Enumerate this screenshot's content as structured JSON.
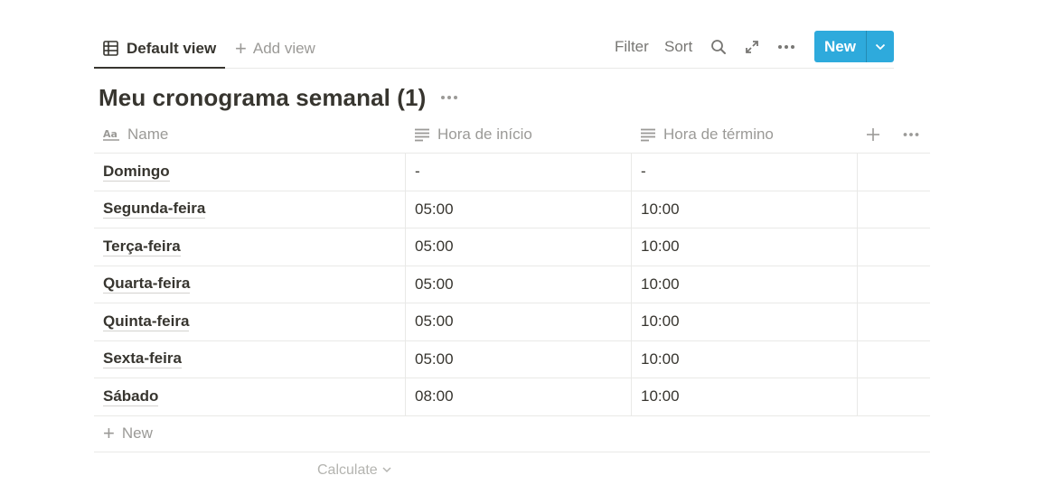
{
  "viewbar": {
    "default_tab": "Default view",
    "add_view": "Add view",
    "filter": "Filter",
    "sort": "Sort",
    "new_button": "New"
  },
  "database": {
    "title": "Meu cronograma semanal (1)"
  },
  "table": {
    "columns": [
      {
        "label": "Name",
        "icon": "title-aa-icon"
      },
      {
        "label": "Hora de início",
        "icon": "text-lines-icon"
      },
      {
        "label": "Hora de término",
        "icon": "text-lines-icon"
      }
    ],
    "rows": [
      {
        "name": "Domingo",
        "start": "-",
        "end": "-"
      },
      {
        "name": "Segunda-feira",
        "start": "05:00",
        "end": "10:00"
      },
      {
        "name": "Terça-feira",
        "start": "05:00",
        "end": "10:00"
      },
      {
        "name": "Quarta-feira",
        "start": "05:00",
        "end": "10:00"
      },
      {
        "name": "Quinta-feira",
        "start": "05:00",
        "end": "10:00"
      },
      {
        "name": "Sexta-feira",
        "start": "05:00",
        "end": "10:00"
      },
      {
        "name": "Sábado",
        "start": "08:00",
        "end": "10:00"
      }
    ],
    "new_row_label": "New",
    "calculate_label": "Calculate"
  },
  "colors": {
    "accent": "#2eaadc",
    "text": "#37352f",
    "muted": "#9b9a97",
    "border": "#e9e9e7"
  }
}
